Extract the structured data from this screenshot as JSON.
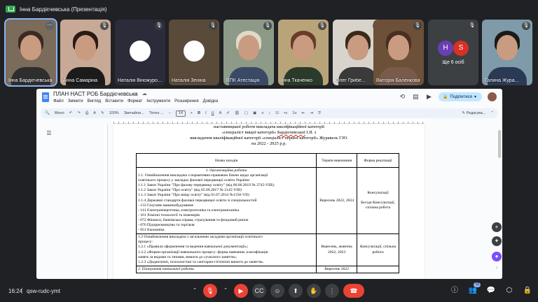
{
  "presenter": {
    "label": "Інна Бардієчевська (Презентація)"
  },
  "participants": [
    {
      "name": "Інна Бардієчевська",
      "hair": "#3b2a22",
      "body": "#2e2e2e",
      "bg": "#7a6b5a",
      "active": true
    },
    {
      "name": "Анна Самаріна",
      "hair": "#2a1a14",
      "body": "#1b1b1b",
      "bg": "#c8a995"
    },
    {
      "name": "Наталія Віножуро...",
      "avatar": true,
      "bg": "#2b2b3a"
    },
    {
      "name": "Наталія Зеніна",
      "avatar": true,
      "bg": "#5a4a3a"
    },
    {
      "name": "ВПК Атестація",
      "hair": "#e0d9c8",
      "body": "#3a4a66",
      "bg": "#8d9a88"
    },
    {
      "name": "Інна Ткаченко",
      "hair": "#6a3a2a",
      "body": "#2b3b2b",
      "bg": "#b9a47a"
    },
    {
      "name": "Олег Грибе...",
      "hair": "#3a2a1a",
      "body": "#3a3a3a",
      "bg": "#d8d4cc"
    },
    {
      "name": "Вікторія Баленкова",
      "hair": "#4a2e22",
      "body": "#7a5b4b",
      "bg": "#6d5038"
    },
    {
      "name": "Галина Жура...",
      "hair": "#1a1a1a",
      "body": "#2a3a55",
      "bg": "#7f9aa8"
    }
  ],
  "more_people": {
    "label": "Ще 6 осіб",
    "initial_1": "H",
    "initial_2": "S",
    "color_1": "#6a3fb5",
    "color_2": "#d93025"
  },
  "doc": {
    "title": "ПЛАН НАСТ РОБ Бардієчевська",
    "menu": [
      "Файл",
      "Змінити",
      "Вигляд",
      "Вставити",
      "Формат",
      "Інструменти",
      "Розширення",
      "Довідка"
    ],
    "share_label": "Поділитися",
    "toolbar": {
      "mode_label": "Мено",
      "zoom": "100%",
      "style": "Звичайни...",
      "font": "Times ...",
      "font_size": "14",
      "edit_mode": "Редагува..."
    },
    "header_lines": [
      "наставницької роботи викладача кваліфікаційної категорії",
      "«спеціаліст вищої категорії» Бардієчевської І.Я. з",
      "викладачем кваліфікаційної категорії «спеціаліст першої категорії» Журавель Г.Ю.",
      "на 2022 - 2025 р.р."
    ],
    "table": {
      "headers": [
        "Назва заходів",
        "Термін виконання",
        "Форма реалізації"
      ],
      "section_1_title": "1. Організаційна робота",
      "row1_lines": [
        "1.1. Ознайомлення викладача з нормативно-правовою базою щодо організації",
        "освітнього процесу у закладах фахової передвищої освіти України:",
        "1.1.1 Закон України \"Про фахову передвищу освіту\" (від 06.06.2019 № 2745-VIII);",
        "1.1.2 Закон України \"Про освіту\" (від 05.09.2017 № 2145-VIII)",
        "1.1.3 Закон України \"Про вищу освіту\" (від 01.07.2014 №1556-VII)",
        "1.1.4 Державні стандарти фахової передвищої освіти зі спеціальностей",
        "- 133 Галузеве машинобудування",
        "- 141 Електроенергетика, електротехніка та електромеханіка",
        "- 161 Хімічні технології та інженерія",
        "- 072 Фінанси, банківська справа, страхування та фондовий ринок",
        "- 076 Підприємництво та торгівля",
        "- 051 Економіка"
      ],
      "row1_term": "Вересень 2022, 2024",
      "row1_form_1": "Консультації",
      "row1_form_2": "Бесіди Консультації, спільна робота",
      "row2_lines": [
        "1.2 Ознайомлення викладача з загальними засадами організації освітнього",
        "процесу:",
        "1.2.1 «Правила оформлення та ведення навчальної документації»;",
        "1.2.2 «Форми організації навчального процесу: форма навчання, класифікація",
        "занять за видами та типами, вимоги до сучасного заняття»;",
        "1.2.3 «Дидактичні, психологічні та санітарно-гігієнічні вимоги до заняття»."
      ],
      "row2_term": "Вересень, жовтень 2022, 2023",
      "row2_form": "Консультації, спільна робота",
      "row3_partial": "2. Планування навчальної роботи",
      "row3_term_partial": "Вересень 2022"
    }
  },
  "bottom": {
    "time": "16:24",
    "code": "qsw-rudc-ymt",
    "participants_badge": "16"
  }
}
